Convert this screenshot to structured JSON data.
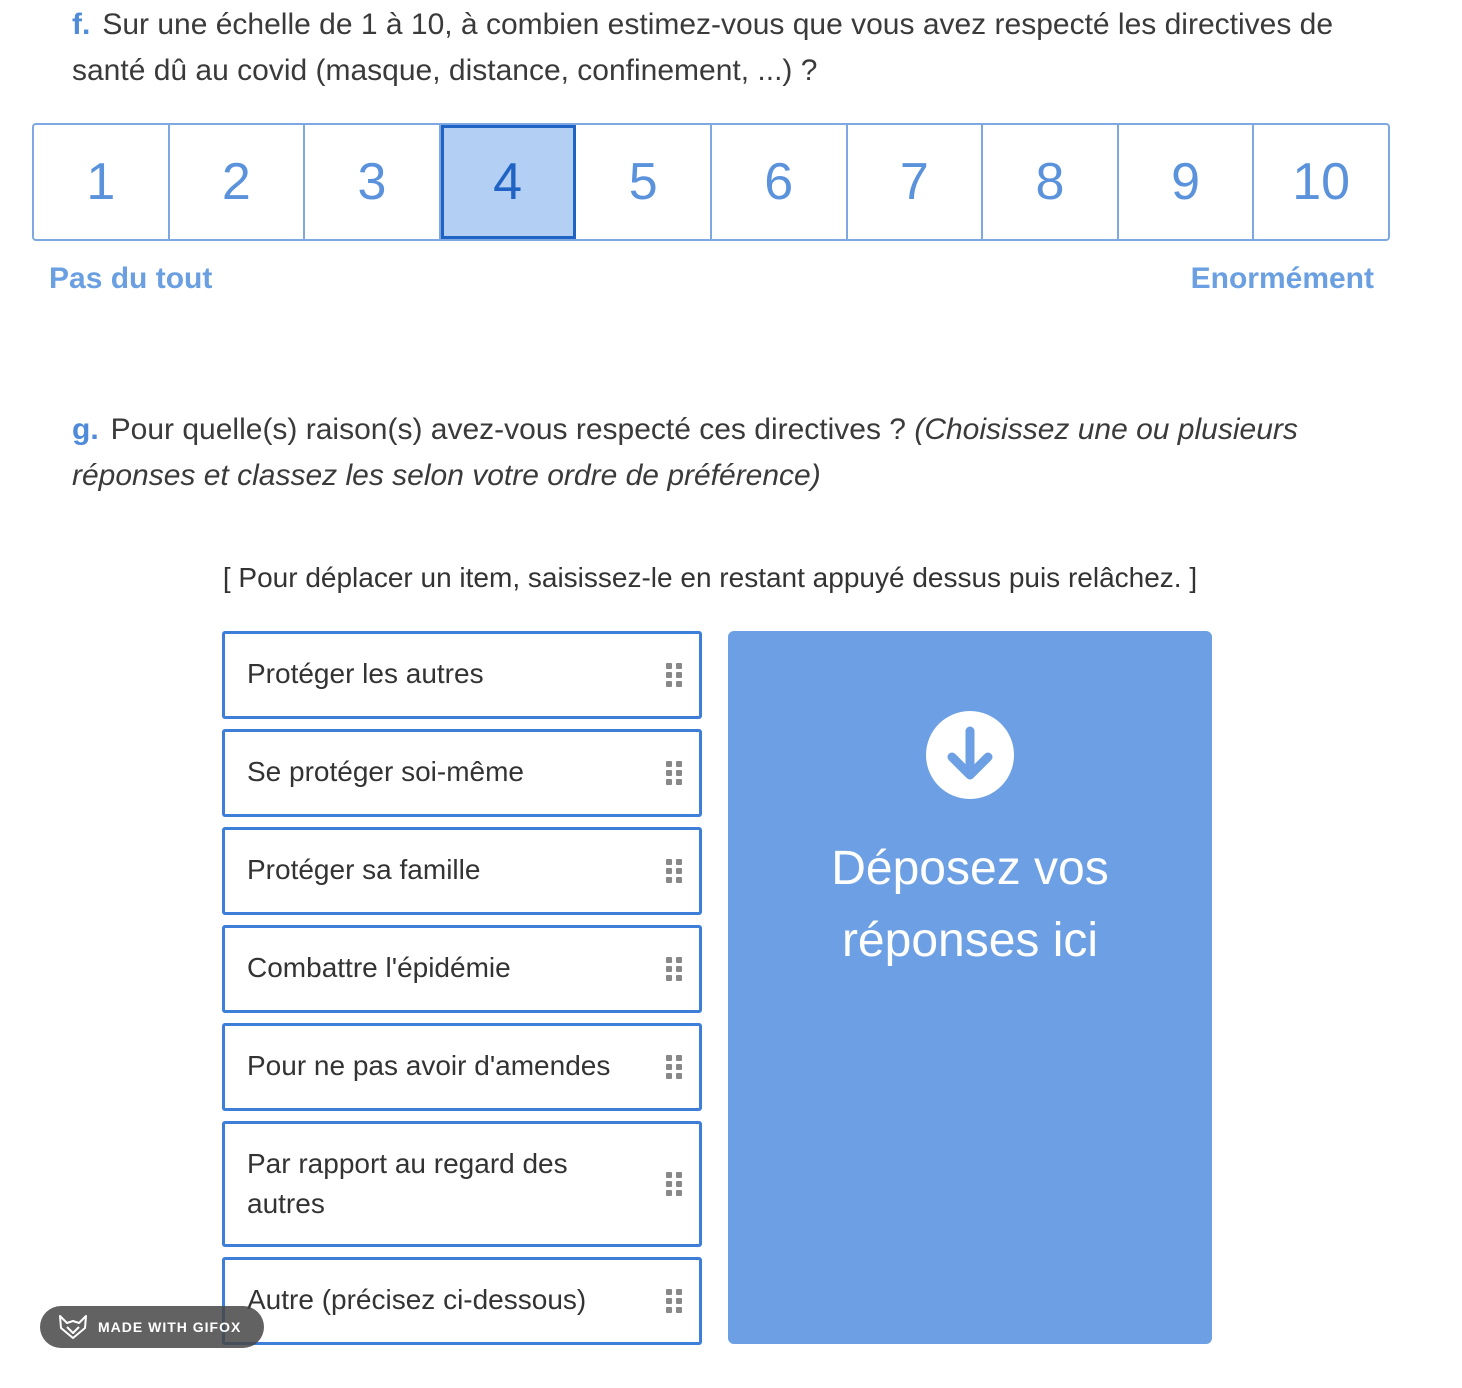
{
  "question_f": {
    "letter": "f.",
    "text": "Sur une échelle de 1 à 10, à combien estimez-vous que vous avez respecté les directives de santé dû au covid (masque, distance, confinement, ...) ?",
    "scale": [
      "1",
      "2",
      "3",
      "4",
      "5",
      "6",
      "7",
      "8",
      "9",
      "10"
    ],
    "selected_value": "4",
    "label_min": "Pas du tout",
    "label_max": "Enormément",
    "colors": {
      "accent": "#5a92dc",
      "selected_bg": "#b3cff4",
      "selected_border": "#1f63c4"
    }
  },
  "question_g": {
    "letter": "g.",
    "text": "Pour quelle(s) raison(s) avez-vous respecté ces directives ?",
    "hint": "(Choisissez une ou plusieurs réponses et classez les selon votre ordre de préférence)",
    "instruction": "[ Pour déplacer un item, saisissez-le en restant appuyé dessus puis relâchez. ]",
    "items": [
      "Protéger les autres",
      "Se protéger soi-même",
      "Protéger sa famille",
      "Combattre l'épidémie",
      "Pour ne pas avoir d'amendes",
      "Par rapport au regard des autres",
      "Autre (précisez ci-dessous)"
    ],
    "dropzone_text": "Déposez vos réponses ici",
    "dropzone_icon": "arrow-down-circle-icon",
    "colors": {
      "item_border": "#3d7fd8",
      "dropzone_bg": "#6c9fe3"
    }
  },
  "watermark": {
    "text": "MADE WITH GIFOX",
    "icon": "fox-logo-icon"
  }
}
